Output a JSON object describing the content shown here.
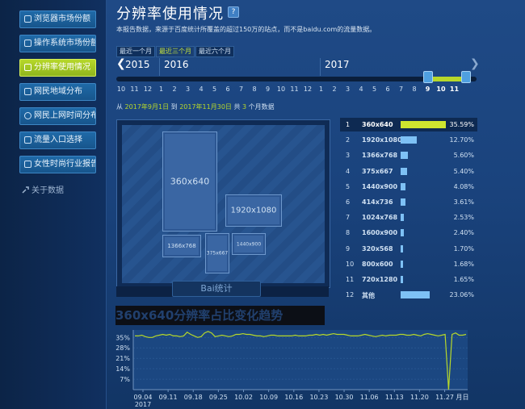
{
  "sidebar": {
    "items": [
      {
        "label": "浏览器市场份额",
        "active": false
      },
      {
        "label": "操作系统市场份额",
        "active": false
      },
      {
        "label": "分辨率使用情况",
        "active": true
      },
      {
        "label": "网民地域分布",
        "active": false
      },
      {
        "label": "网民上网时间分布",
        "active": false
      },
      {
        "label": "流量入口选择",
        "active": false
      },
      {
        "label": "女性时尚行业报告",
        "active": false
      }
    ],
    "about": "关于数据"
  },
  "header": {
    "title": "分辨率使用情况",
    "help": "?",
    "description": "本报告数据，来源于百度统计所覆盖的超过150万的站点，而不是baidu.com的流量数据。",
    "range_tabs": [
      "最近一个月",
      "最近三个月",
      "最近六个月"
    ],
    "active_range": 1
  },
  "timeline": {
    "prev_year": "2015",
    "years": [
      "2016",
      "2017"
    ],
    "months": [
      "10",
      "11",
      "12",
      "1",
      "2",
      "3",
      "4",
      "5",
      "6",
      "7",
      "8",
      "9",
      "10",
      "11",
      "12",
      "1",
      "2",
      "3",
      "4",
      "5",
      "6",
      "7",
      "8",
      "9",
      "10",
      "11"
    ],
    "selected_months": [
      "9",
      "10",
      "11"
    ]
  },
  "period": {
    "from_label": "从",
    "from": "2017年9月1日",
    "to_label": "到",
    "to": "2017年11月30日",
    "total_label": "共",
    "count": "3",
    "suffix": "个月数据"
  },
  "screen": {
    "boxes": [
      "360x640",
      "1920x1080",
      "1366x768",
      "375x667",
      "1440x900"
    ],
    "brand": "Bai统计"
  },
  "ranking": [
    {
      "rank": "1",
      "label": "360x640",
      "value": "35.59%",
      "pct": 35.59
    },
    {
      "rank": "2",
      "label": "1920x1080",
      "value": "12.70%",
      "pct": 12.7
    },
    {
      "rank": "3",
      "label": "1366x768",
      "value": "5.60%",
      "pct": 5.6
    },
    {
      "rank": "4",
      "label": "375x667",
      "value": "5.40%",
      "pct": 5.4
    },
    {
      "rank": "5",
      "label": "1440x900",
      "value": "4.08%",
      "pct": 4.08
    },
    {
      "rank": "6",
      "label": "414x736",
      "value": "3.61%",
      "pct": 3.61
    },
    {
      "rank": "7",
      "label": "1024x768",
      "value": "2.53%",
      "pct": 2.53
    },
    {
      "rank": "8",
      "label": "1600x900",
      "value": "2.40%",
      "pct": 2.4
    },
    {
      "rank": "9",
      "label": "320x568",
      "value": "1.70%",
      "pct": 1.7
    },
    {
      "rank": "10",
      "label": "800x600",
      "value": "1.68%",
      "pct": 1.68
    },
    {
      "rank": "11",
      "label": "720x1280",
      "value": "1.65%",
      "pct": 1.65
    },
    {
      "rank": "12",
      "label": "其他",
      "value": "23.06%",
      "pct": 23.06
    }
  ],
  "colors": {
    "accent": "#b7d82a",
    "bar": "#7ec1f5",
    "line": "#b7d82a"
  },
  "chart_data": {
    "type": "line",
    "title": "360x640分辨率占比变化趋势",
    "yticks": [
      "35%",
      "28%",
      "21%",
      "14%",
      "7%"
    ],
    "ylim": [
      0,
      40
    ],
    "xticks": [
      "09.04",
      "09.11",
      "09.18",
      "09.25",
      "10.02",
      "10.09",
      "10.16",
      "10.23",
      "10.30",
      "11.06",
      "11.13",
      "11.20",
      "11.27"
    ],
    "xunit": "月日",
    "year_label": "2017",
    "grid": true,
    "series": [
      {
        "values": [
          36,
          36,
          36.5,
          35.5,
          35,
          35,
          36,
          36.5,
          37,
          36.5,
          37,
          36,
          36,
          35.5,
          36,
          38.5,
          37,
          36,
          35,
          35.5,
          38,
          39,
          38,
          35.5,
          36,
          36.5,
          36,
          35.5,
          36,
          37,
          37,
          37.5,
          37,
          37,
          36.5,
          36,
          36,
          35.5,
          36,
          36.5,
          36.5,
          36,
          36,
          36,
          36,
          36,
          36.5,
          36,
          36,
          36,
          36.5,
          36.5,
          37,
          36.5,
          37,
          36.5,
          37,
          37.5,
          37,
          37,
          37,
          36.5,
          36,
          36,
          36,
          36.5,
          37,
          36.5,
          36,
          35.5,
          36,
          36.5,
          36,
          36.5,
          36.5,
          36.5,
          37,
          37,
          36.5,
          36.5,
          37,
          36.5,
          36,
          37,
          37.5,
          37,
          36.5,
          36,
          36.5,
          37,
          0,
          37,
          38,
          36.5,
          36.5,
          37
        ]
      }
    ]
  }
}
